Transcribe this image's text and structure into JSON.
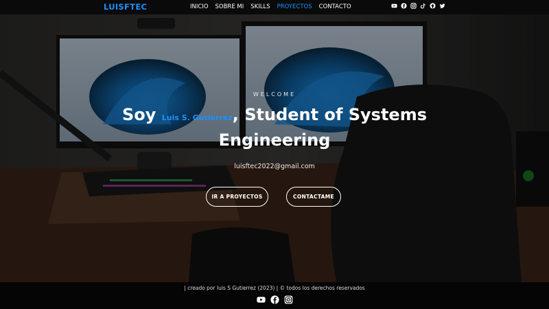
{
  "navbar": {
    "brand": "LUISFTEC",
    "links": [
      "INICIO",
      "SOBRE MI",
      "SKILLS",
      "PROYECTOS",
      "CONTACTO"
    ],
    "active_link": "PROYECTOS",
    "social_icons": [
      "youtube-icon",
      "facebook-icon",
      "instagram-icon",
      "tiktok-icon",
      "github-icon",
      "twitter-icon"
    ]
  },
  "hero": {
    "welcome": "WELCOME",
    "headline_prefix": "Soy",
    "name": "Luis S. Gutierrez",
    "headline_suffix": ", Student of Systems Engineering",
    "email": "luisftec2022@gmail.com",
    "btn_projects": "IR A PROYECTOS",
    "btn_contact": "CONTACTAME"
  },
  "footer": {
    "text": "| creado por luis S Gutierrez (2023) | © todos los derechos reservados",
    "icons": [
      "youtube-icon",
      "facebook-icon",
      "instagram-icon"
    ]
  },
  "colors": {
    "accent": "#1e90ff",
    "nav_bg": "#0a0a0a",
    "footer_bg": "#050505"
  }
}
